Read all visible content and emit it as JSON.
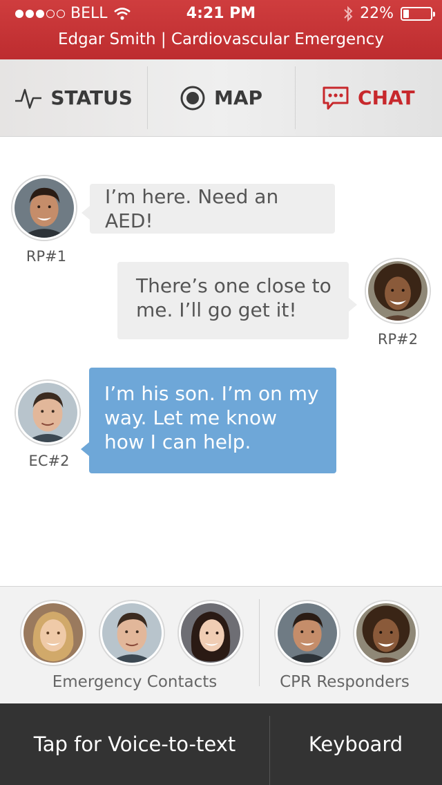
{
  "status_bar": {
    "carrier": "BELL",
    "time": "4:21 PM",
    "battery": "22%",
    "battery_level": 0.22
  },
  "header": {
    "subtitle": "Edgar Smith | Cardiovascular Emergency"
  },
  "tabs": [
    {
      "label": "STATUS",
      "icon": "pulse-icon",
      "active": false
    },
    {
      "label": "MAP",
      "icon": "target-icon",
      "active": false
    },
    {
      "label": "CHAT",
      "icon": "chat-bubble-icon",
      "active": true
    }
  ],
  "messages": [
    {
      "sender": "RP#1",
      "text": "I’m here. Need an AED!",
      "side": "left",
      "style": "gray"
    },
    {
      "sender": "RP#2",
      "text": "There’s one close to me. I’ll go get it!",
      "side": "right",
      "style": "gray"
    },
    {
      "sender": "EC#2",
      "text": "I’m his son. I’m on my way. Let me know how I can help.",
      "side": "left",
      "style": "blue"
    }
  ],
  "groups": {
    "emergency_contacts_label": "Emergency Contacts",
    "cpr_responders_label": "CPR Responders"
  },
  "bottom_bar": {
    "voice_label": "Tap for Voice-to-text",
    "keyboard_label": "Keyboard"
  },
  "colors": {
    "brand_red": "#c7282c",
    "bubble_blue": "#6ea7d8",
    "bubble_gray": "#eeeeee",
    "bottom_bar": "#333333"
  }
}
